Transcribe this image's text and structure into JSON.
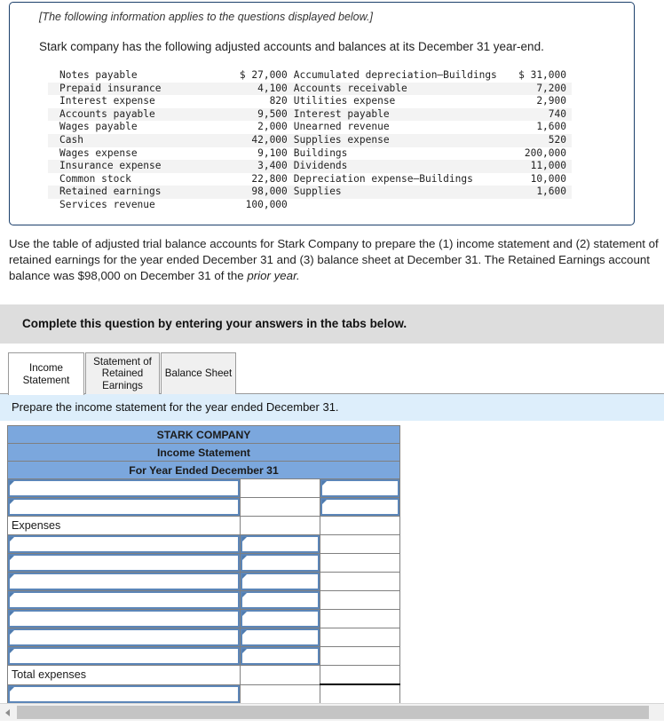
{
  "info_card": {
    "italic_note": "[The following information applies to the questions displayed below.]",
    "lead_text": "Stark company has the following adjusted accounts and balances at its December 31 year-end.",
    "trial_balance": [
      {
        "name1": "Notes payable",
        "amt1": "$ 27,000",
        "name2": "Accumulated depreciation–Buildings",
        "amt2": "$ 31,000"
      },
      {
        "name1": "Prepaid insurance",
        "amt1": "4,100",
        "name2": "Accounts receivable",
        "amt2": "7,200"
      },
      {
        "name1": "Interest expense",
        "amt1": "820",
        "name2": "Utilities expense",
        "amt2": "2,900"
      },
      {
        "name1": "Accounts payable",
        "amt1": "9,500",
        "name2": "Interest payable",
        "amt2": "740"
      },
      {
        "name1": "Wages payable",
        "amt1": "2,000",
        "name2": "Unearned revenue",
        "amt2": "1,600"
      },
      {
        "name1": "Cash",
        "amt1": "42,000",
        "name2": "Supplies expense",
        "amt2": "520"
      },
      {
        "name1": "Wages expense",
        "amt1": "9,100",
        "name2": "Buildings",
        "amt2": "200,000"
      },
      {
        "name1": "Insurance expense",
        "amt1": "3,400",
        "name2": "Dividends",
        "amt2": "11,000"
      },
      {
        "name1": "Common stock",
        "amt1": "22,800",
        "name2": "Depreciation expense–Buildings",
        "amt2": "10,000"
      },
      {
        "name1": "Retained earnings",
        "amt1": "98,000",
        "name2": "Supplies",
        "amt2": "1,600"
      },
      {
        "name1": "Services revenue",
        "amt1": "100,000",
        "name2": "",
        "amt2": ""
      }
    ]
  },
  "prompt": {
    "part_1": "Use the table of adjusted trial balance accounts for Stark Company to prepare the (1) income statement and (2) statement of retained earnings for the year ended December 31 and (3) balance sheet at December 31. The Retained Earnings account balance was $98,000 on December 31 of the ",
    "italic_part": "prior year.",
    "part_2": ""
  },
  "gray_banner": {
    "text": "Complete this question by entering your answers in the tabs below."
  },
  "tabs": [
    {
      "label": "Income Statement",
      "active": true
    },
    {
      "label": "Statement of Retained Earnings",
      "active": false
    },
    {
      "label": "Balance Sheet",
      "active": false
    }
  ],
  "sub_instruction": {
    "text": "Prepare the income statement for the year ended December 31."
  },
  "worksheet": {
    "headers": [
      "STARK COMPANY",
      "Income Statement",
      "For Year Ended December 31"
    ],
    "rows": [
      {
        "kind": "input",
        "desc": "",
        "sub": "",
        "tot": "",
        "desc_edit": true,
        "sub_edit": false,
        "tot_edit": true
      },
      {
        "kind": "input",
        "desc": "",
        "sub": "",
        "tot": "",
        "desc_edit": true,
        "sub_edit": false,
        "tot_edit": true
      },
      {
        "kind": "label",
        "desc": "Expenses",
        "sub": "",
        "tot": "",
        "desc_edit": false,
        "sub_edit": false,
        "tot_edit": false
      },
      {
        "kind": "input",
        "desc": "",
        "sub": "",
        "tot": "",
        "desc_edit": true,
        "sub_edit": true,
        "tot_edit": false
      },
      {
        "kind": "input",
        "desc": "",
        "sub": "",
        "tot": "",
        "desc_edit": true,
        "sub_edit": true,
        "tot_edit": false
      },
      {
        "kind": "input",
        "desc": "",
        "sub": "",
        "tot": "",
        "desc_edit": true,
        "sub_edit": true,
        "tot_edit": false
      },
      {
        "kind": "input",
        "desc": "",
        "sub": "",
        "tot": "",
        "desc_edit": true,
        "sub_edit": true,
        "tot_edit": false
      },
      {
        "kind": "input",
        "desc": "",
        "sub": "",
        "tot": "",
        "desc_edit": true,
        "sub_edit": true,
        "tot_edit": false
      },
      {
        "kind": "input",
        "desc": "",
        "sub": "",
        "tot": "",
        "desc_edit": true,
        "sub_edit": true,
        "tot_edit": false
      },
      {
        "kind": "input",
        "desc": "",
        "sub": "",
        "tot": "",
        "desc_edit": true,
        "sub_edit": true,
        "tot_edit": false
      },
      {
        "kind": "label",
        "desc": "Total expenses",
        "sub": "",
        "tot": "",
        "desc_edit": false,
        "sub_edit": false,
        "tot_edit": false
      },
      {
        "kind": "net",
        "desc": "",
        "sub": "",
        "tot": "",
        "desc_edit": true,
        "sub_edit": false,
        "tot_edit": false
      }
    ]
  },
  "scrollbar": {
    "left_arrow": "◀"
  },
  "colors": {
    "header_blue": "#7ba7dd",
    "instruction_blue": "#ddeefb",
    "banner_gray": "#dddddd",
    "card_border": "#1b3f6b",
    "input_border": "#5c86b8"
  }
}
